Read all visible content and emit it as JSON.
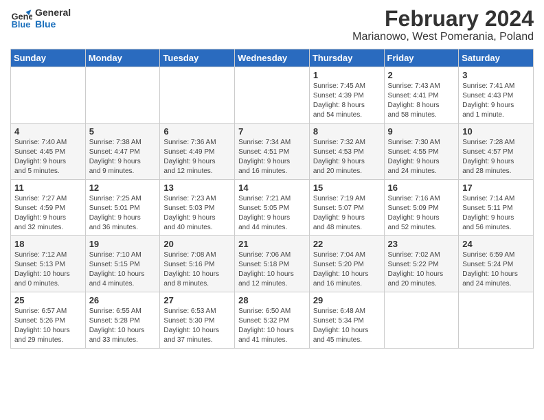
{
  "logo": {
    "line1": "General",
    "line2": "Blue"
  },
  "title": "February 2024",
  "location": "Marianowo, West Pomerania, Poland",
  "days_of_week": [
    "Sunday",
    "Monday",
    "Tuesday",
    "Wednesday",
    "Thursday",
    "Friday",
    "Saturday"
  ],
  "weeks": [
    [
      {
        "day": "",
        "info": ""
      },
      {
        "day": "",
        "info": ""
      },
      {
        "day": "",
        "info": ""
      },
      {
        "day": "",
        "info": ""
      },
      {
        "day": "1",
        "info": "Sunrise: 7:45 AM\nSunset: 4:39 PM\nDaylight: 8 hours\nand 54 minutes."
      },
      {
        "day": "2",
        "info": "Sunrise: 7:43 AM\nSunset: 4:41 PM\nDaylight: 8 hours\nand 58 minutes."
      },
      {
        "day": "3",
        "info": "Sunrise: 7:41 AM\nSunset: 4:43 PM\nDaylight: 9 hours\nand 1 minute."
      }
    ],
    [
      {
        "day": "4",
        "info": "Sunrise: 7:40 AM\nSunset: 4:45 PM\nDaylight: 9 hours\nand 5 minutes."
      },
      {
        "day": "5",
        "info": "Sunrise: 7:38 AM\nSunset: 4:47 PM\nDaylight: 9 hours\nand 9 minutes."
      },
      {
        "day": "6",
        "info": "Sunrise: 7:36 AM\nSunset: 4:49 PM\nDaylight: 9 hours\nand 12 minutes."
      },
      {
        "day": "7",
        "info": "Sunrise: 7:34 AM\nSunset: 4:51 PM\nDaylight: 9 hours\nand 16 minutes."
      },
      {
        "day": "8",
        "info": "Sunrise: 7:32 AM\nSunset: 4:53 PM\nDaylight: 9 hours\nand 20 minutes."
      },
      {
        "day": "9",
        "info": "Sunrise: 7:30 AM\nSunset: 4:55 PM\nDaylight: 9 hours\nand 24 minutes."
      },
      {
        "day": "10",
        "info": "Sunrise: 7:28 AM\nSunset: 4:57 PM\nDaylight: 9 hours\nand 28 minutes."
      }
    ],
    [
      {
        "day": "11",
        "info": "Sunrise: 7:27 AM\nSunset: 4:59 PM\nDaylight: 9 hours\nand 32 minutes."
      },
      {
        "day": "12",
        "info": "Sunrise: 7:25 AM\nSunset: 5:01 PM\nDaylight: 9 hours\nand 36 minutes."
      },
      {
        "day": "13",
        "info": "Sunrise: 7:23 AM\nSunset: 5:03 PM\nDaylight: 9 hours\nand 40 minutes."
      },
      {
        "day": "14",
        "info": "Sunrise: 7:21 AM\nSunset: 5:05 PM\nDaylight: 9 hours\nand 44 minutes."
      },
      {
        "day": "15",
        "info": "Sunrise: 7:19 AM\nSunset: 5:07 PM\nDaylight: 9 hours\nand 48 minutes."
      },
      {
        "day": "16",
        "info": "Sunrise: 7:16 AM\nSunset: 5:09 PM\nDaylight: 9 hours\nand 52 minutes."
      },
      {
        "day": "17",
        "info": "Sunrise: 7:14 AM\nSunset: 5:11 PM\nDaylight: 9 hours\nand 56 minutes."
      }
    ],
    [
      {
        "day": "18",
        "info": "Sunrise: 7:12 AM\nSunset: 5:13 PM\nDaylight: 10 hours\nand 0 minutes."
      },
      {
        "day": "19",
        "info": "Sunrise: 7:10 AM\nSunset: 5:15 PM\nDaylight: 10 hours\nand 4 minutes."
      },
      {
        "day": "20",
        "info": "Sunrise: 7:08 AM\nSunset: 5:16 PM\nDaylight: 10 hours\nand 8 minutes."
      },
      {
        "day": "21",
        "info": "Sunrise: 7:06 AM\nSunset: 5:18 PM\nDaylight: 10 hours\nand 12 minutes."
      },
      {
        "day": "22",
        "info": "Sunrise: 7:04 AM\nSunset: 5:20 PM\nDaylight: 10 hours\nand 16 minutes."
      },
      {
        "day": "23",
        "info": "Sunrise: 7:02 AM\nSunset: 5:22 PM\nDaylight: 10 hours\nand 20 minutes."
      },
      {
        "day": "24",
        "info": "Sunrise: 6:59 AM\nSunset: 5:24 PM\nDaylight: 10 hours\nand 24 minutes."
      }
    ],
    [
      {
        "day": "25",
        "info": "Sunrise: 6:57 AM\nSunset: 5:26 PM\nDaylight: 10 hours\nand 29 minutes."
      },
      {
        "day": "26",
        "info": "Sunrise: 6:55 AM\nSunset: 5:28 PM\nDaylight: 10 hours\nand 33 minutes."
      },
      {
        "day": "27",
        "info": "Sunrise: 6:53 AM\nSunset: 5:30 PM\nDaylight: 10 hours\nand 37 minutes."
      },
      {
        "day": "28",
        "info": "Sunrise: 6:50 AM\nSunset: 5:32 PM\nDaylight: 10 hours\nand 41 minutes."
      },
      {
        "day": "29",
        "info": "Sunrise: 6:48 AM\nSunset: 5:34 PM\nDaylight: 10 hours\nand 45 minutes."
      },
      {
        "day": "",
        "info": ""
      },
      {
        "day": "",
        "info": ""
      }
    ]
  ]
}
